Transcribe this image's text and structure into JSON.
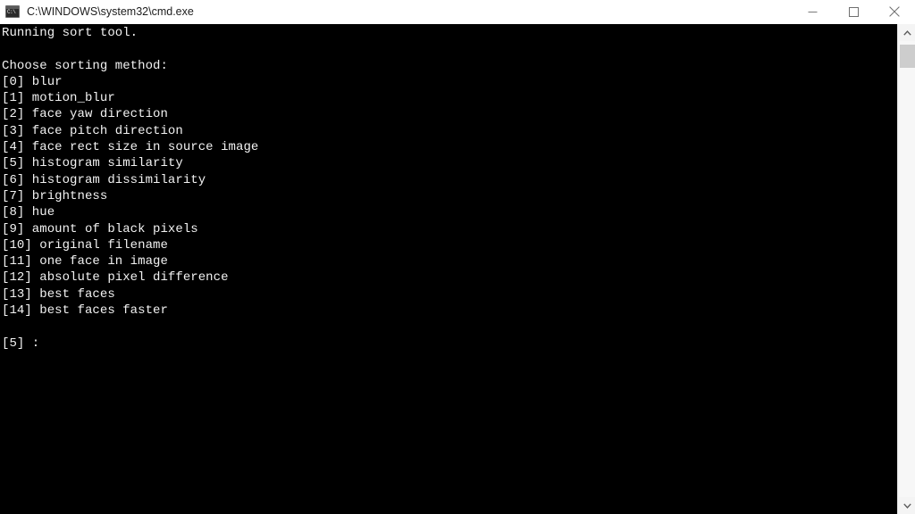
{
  "window": {
    "title": "C:\\WINDOWS\\system32\\cmd.exe",
    "icon": "cmd-console-icon",
    "controls": {
      "minimize_label": "Minimize",
      "maximize_label": "Maximize",
      "close_label": "Close"
    }
  },
  "console": {
    "background_color": "#000000",
    "foreground_color": "#f2f2f2",
    "lines": [
      "Running sort tool.",
      "",
      "Choose sorting method:",
      "[0] blur",
      "[1] motion_blur",
      "[2] face yaw direction",
      "[3] face pitch direction",
      "[4] face rect size in source image",
      "[5] histogram similarity",
      "[6] histogram dissimilarity",
      "[7] brightness",
      "[8] hue",
      "[9] amount of black pixels",
      "[10] original filename",
      "[11] one face in image",
      "[12] absolute pixel difference",
      "[13] best faces",
      "[14] best faces faster",
      "",
      "[5] :"
    ],
    "header_text": "Running sort tool.",
    "menu_prompt": "Choose sorting method:",
    "options": [
      {
        "index": "[0]",
        "label": "blur"
      },
      {
        "index": "[1]",
        "label": "motion_blur"
      },
      {
        "index": "[2]",
        "label": "face yaw direction"
      },
      {
        "index": "[3]",
        "label": "face pitch direction"
      },
      {
        "index": "[4]",
        "label": "face rect size in source image"
      },
      {
        "index": "[5]",
        "label": "histogram similarity"
      },
      {
        "index": "[6]",
        "label": "histogram dissimilarity"
      },
      {
        "index": "[7]",
        "label": "brightness"
      },
      {
        "index": "[8]",
        "label": "hue"
      },
      {
        "index": "[9]",
        "label": "amount of black pixels"
      },
      {
        "index": "[10]",
        "label": "original filename"
      },
      {
        "index": "[11]",
        "label": "one face in image"
      },
      {
        "index": "[12]",
        "label": "absolute pixel difference"
      },
      {
        "index": "[13]",
        "label": "best faces"
      },
      {
        "index": "[14]",
        "label": "best faces faster"
      }
    ],
    "input_prompt": "[5] :",
    "input_default": "5",
    "input_value": ""
  },
  "scrollbar": {
    "up_arrow": "chevron-up-icon",
    "down_arrow": "chevron-down-icon",
    "thumb_color": "#cdcdcd",
    "track_color": "#f7f7f7"
  }
}
